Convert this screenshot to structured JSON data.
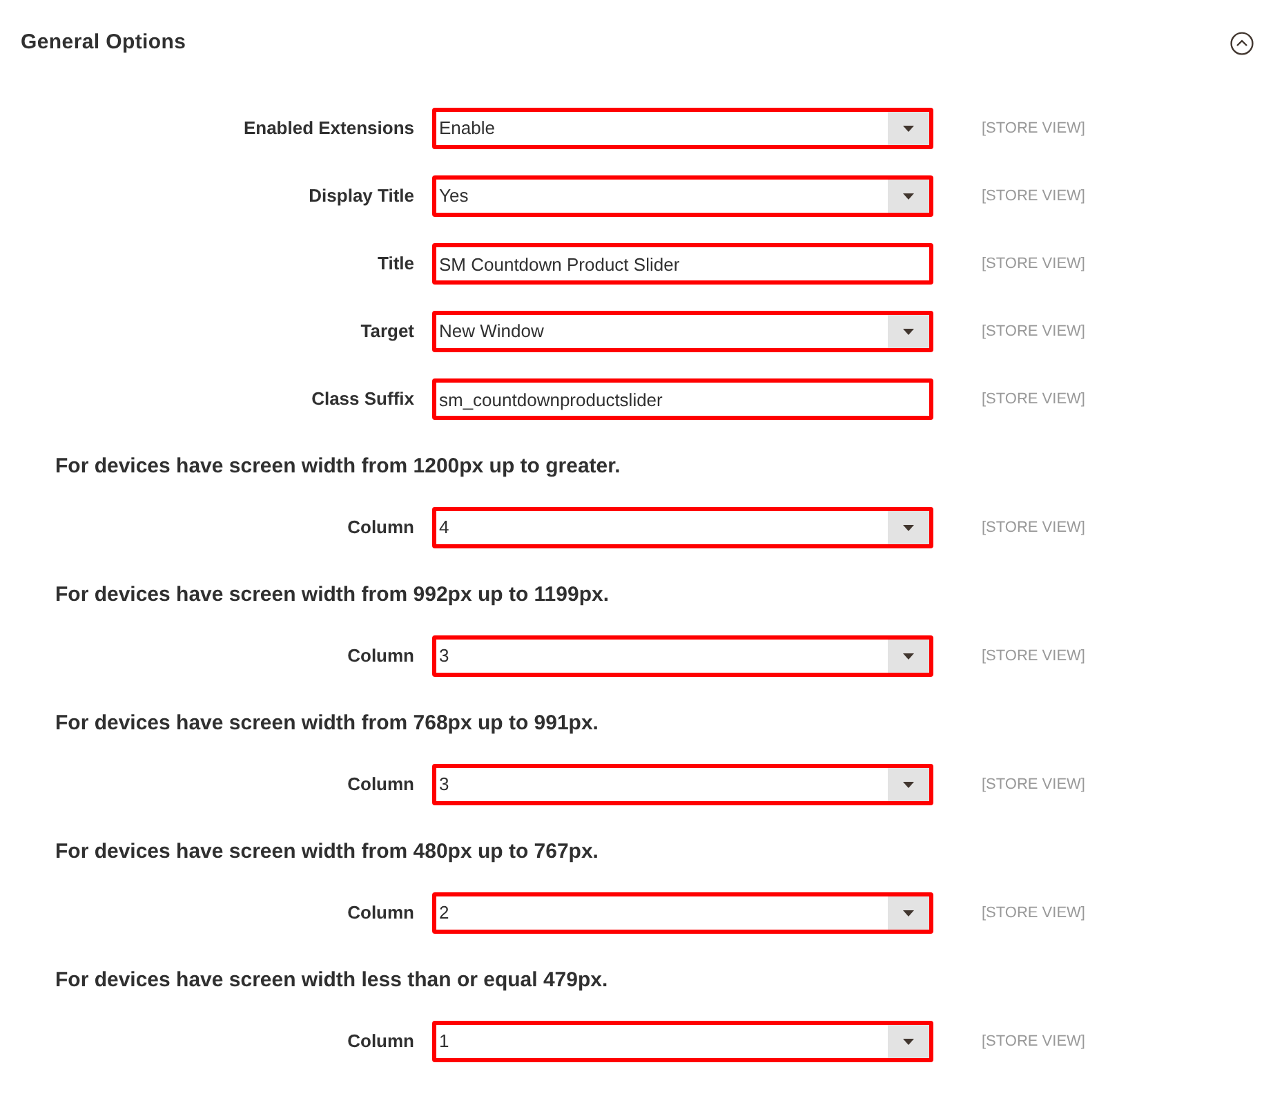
{
  "section": {
    "title": "General Options",
    "expanded": true
  },
  "fields": [
    {
      "kind": "select",
      "label": "Enabled Extensions",
      "value": "Enable",
      "scope": "[STORE VIEW]",
      "highlighted": true
    },
    {
      "kind": "select",
      "label": "Display Title",
      "value": "Yes",
      "scope": "[STORE VIEW]",
      "highlighted": true
    },
    {
      "kind": "text",
      "label": "Title",
      "value": "SM Countdown Product Slider",
      "scope": "[STORE VIEW]",
      "highlighted": true
    },
    {
      "kind": "select",
      "label": "Target",
      "value": "New Window",
      "scope": "[STORE VIEW]",
      "highlighted": true
    },
    {
      "kind": "text",
      "label": "Class Suffix",
      "value": "sm_countdownproductslider",
      "scope": "[STORE VIEW]",
      "highlighted": true
    }
  ],
  "device_groups": [
    {
      "heading": "For devices have screen width from 1200px up to greater.",
      "fields": [
        {
          "kind": "select",
          "label": "Column",
          "value": "4",
          "scope": "[STORE VIEW]",
          "highlighted": true
        }
      ]
    },
    {
      "heading": "For devices have screen width from 992px up to 1199px.",
      "fields": [
        {
          "kind": "select",
          "label": "Column",
          "value": "3",
          "scope": "[STORE VIEW]",
          "highlighted": true
        }
      ]
    },
    {
      "heading": "For devices have screen width from 768px up to 991px.",
      "fields": [
        {
          "kind": "select",
          "label": "Column",
          "value": "3",
          "scope": "[STORE VIEW]",
          "highlighted": true
        }
      ]
    },
    {
      "heading": "For devices have screen width from 480px up to 767px.",
      "fields": [
        {
          "kind": "select",
          "label": "Column",
          "value": "2",
          "scope": "[STORE VIEW]",
          "highlighted": true
        }
      ]
    },
    {
      "heading": "For devices have screen width less than or equal 479px.",
      "fields": [
        {
          "kind": "select",
          "label": "Column",
          "value": "1",
          "scope": "[STORE VIEW]",
          "highlighted": true
        }
      ]
    }
  ]
}
